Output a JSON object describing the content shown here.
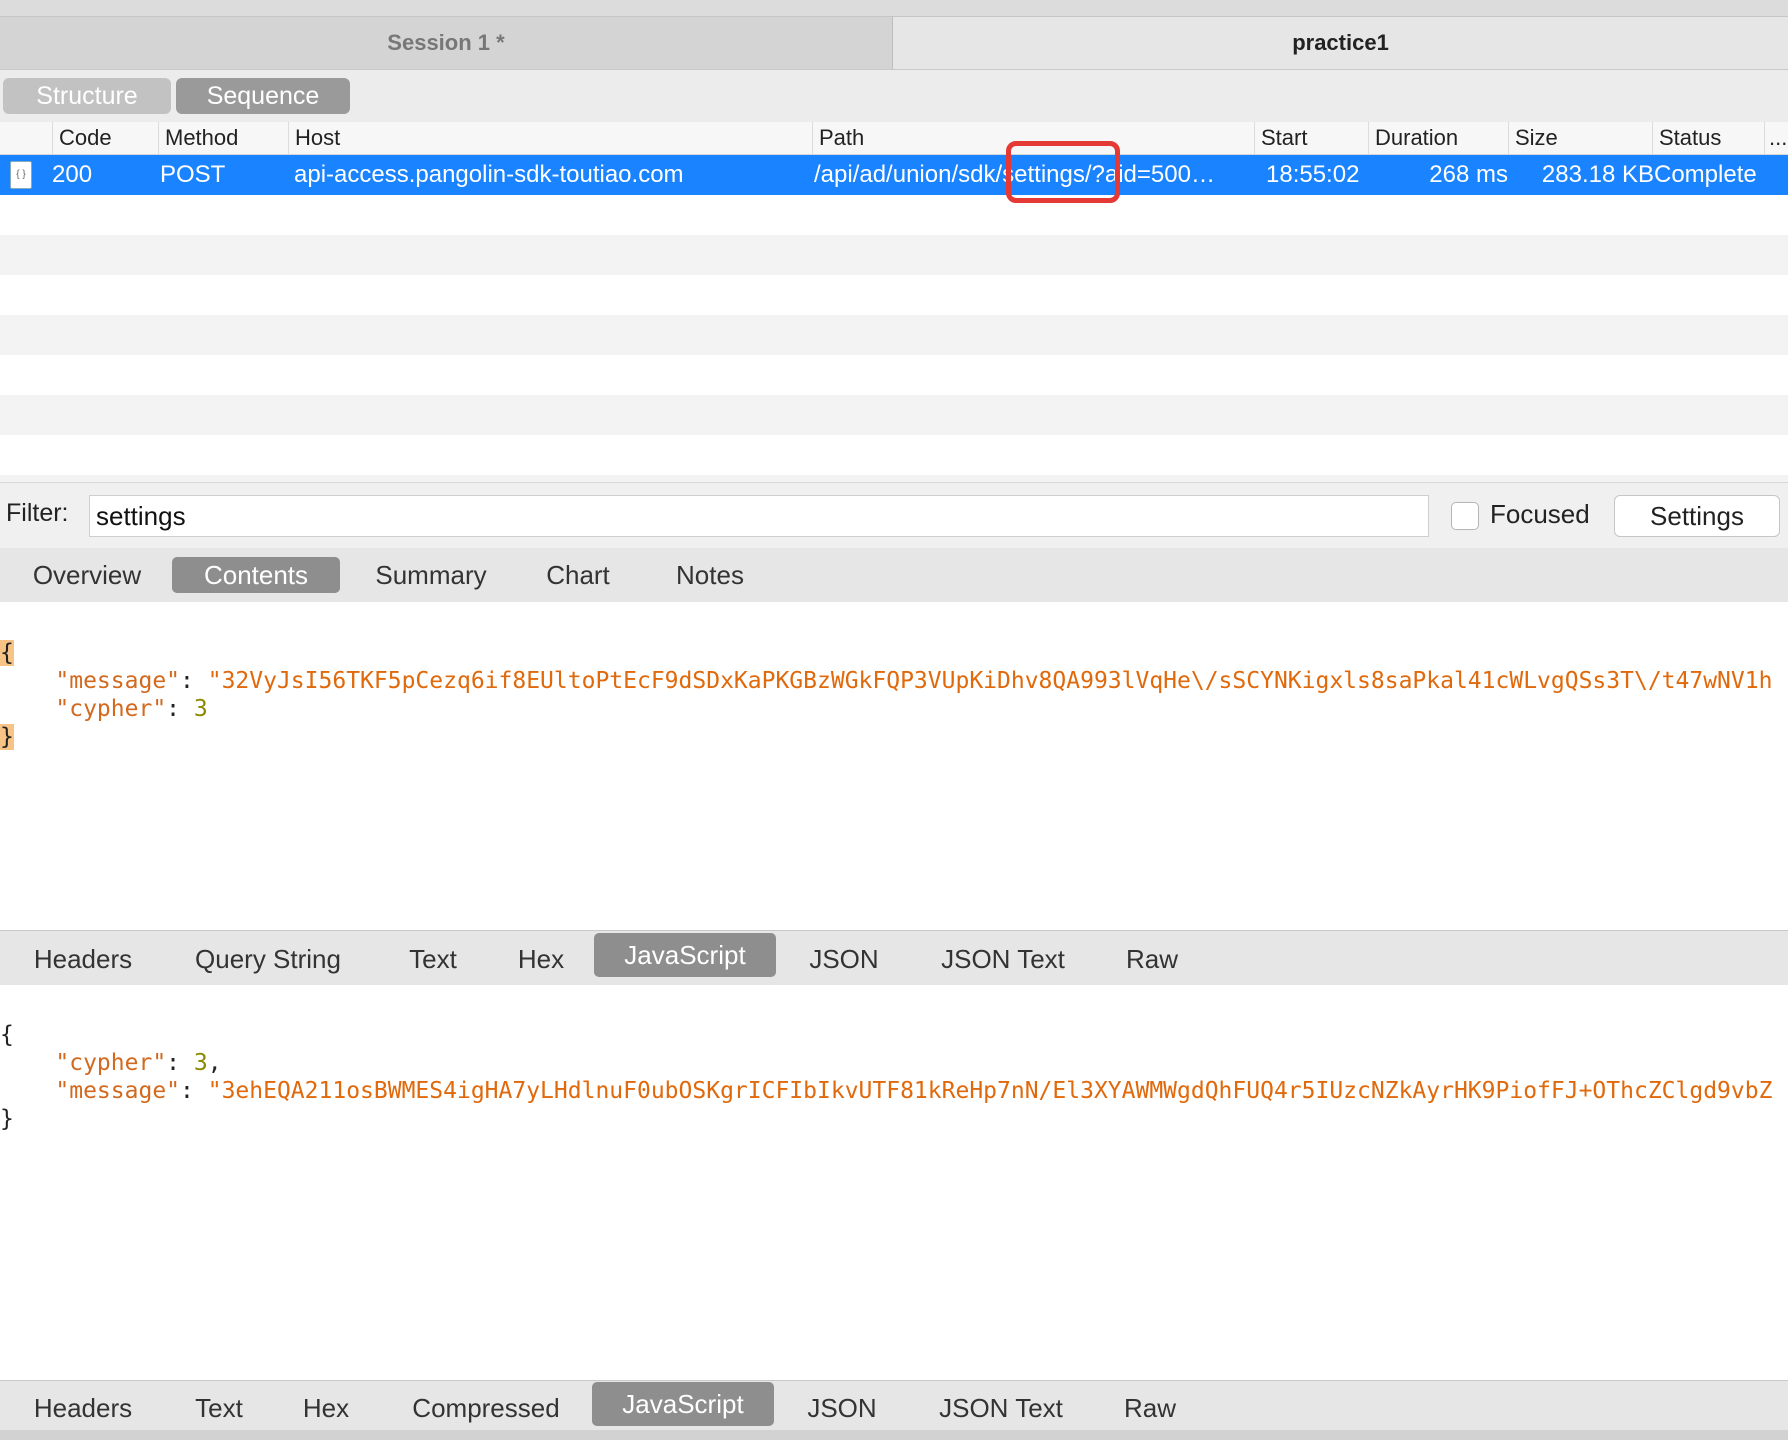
{
  "session_tabs": [
    "Session 1 *",
    "practice1"
  ],
  "view_buttons": {
    "structure": "Structure",
    "sequence": "Sequence"
  },
  "table": {
    "columns": [
      "Code",
      "Method",
      "Host",
      "Path",
      "Start",
      "Duration",
      "Size",
      "Status",
      "..."
    ],
    "rows": [
      {
        "code": "200",
        "method": "POST",
        "host": "api-access.pangolin-sdk-toutiao.com",
        "path_prefix": "/api/ad/union/sdk",
        "path_highlight": "/settings/",
        "path_suffix": "?aid=500…",
        "start": "18:55:02",
        "duration": "268 ms",
        "size": "283.18 KB",
        "status": "Complete"
      }
    ]
  },
  "filter": {
    "label": "Filter:",
    "value": "settings",
    "focused_label": "Focused",
    "settings_button": "Settings"
  },
  "detail_tabs": [
    "Overview",
    "Contents",
    "Summary",
    "Chart",
    "Notes"
  ],
  "request_tabs": [
    "Headers",
    "Query String",
    "Text",
    "Hex",
    "JavaScript",
    "JSON",
    "JSON Text",
    "Raw"
  ],
  "request_body": {
    "open": "{",
    "message_key": "\"message\"",
    "message_value": "\"32VyJsI56TKF5pCezq6if8EUltoPtEcF9dSDxKaPKGBzWGkFQP3VUpKiDhv8QA993lVqHe\\/sSCYNKigxls8saPkal41cWLvgQSs3T\\/t47wNV1h",
    "cypher_key": "\"cypher\"",
    "cypher_value": "3",
    "close": "}"
  },
  "response_body": {
    "open": "{",
    "cypher_key": "\"cypher\"",
    "cypher_value": "3",
    "message_key": "\"message\"",
    "message_value": "\"3ehEQA211osBWMES4igHA7yLHdlnuF0ubOSKgrICFIbIkvUTF81kReHp7nN/El3XYAWMWgdQhFUQ4r5IUzcNZkAyrHK9PiofFJ+OThcZClgd9vbZ",
    "close": "}"
  },
  "response_tabs": [
    "Headers",
    "Text",
    "Hex",
    "Compressed",
    "JavaScript",
    "JSON",
    "JSON Text",
    "Raw"
  ]
}
